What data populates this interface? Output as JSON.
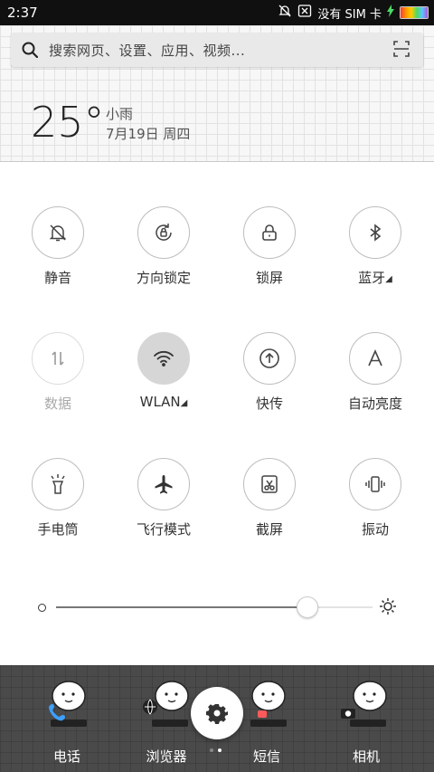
{
  "status_bar": {
    "time": "2:37",
    "carrier": "没有 SIM 卡",
    "battery_colors": [
      "#ff3b30",
      "#ff9500",
      "#ffcc00",
      "#4cd964",
      "#5ac8fa",
      "#af52de"
    ]
  },
  "search": {
    "placeholder": "搜索网页、设置、应用、视频..."
  },
  "weather": {
    "temperature": "25°",
    "condition": "小雨",
    "date": "7月19日 周四"
  },
  "toggles": [
    {
      "label": "静音",
      "state": "active"
    },
    {
      "label": "方向锁定",
      "state": "off"
    },
    {
      "label": "锁屏",
      "state": "off"
    },
    {
      "label": "蓝牙",
      "state": "off",
      "has_more": true
    },
    {
      "label": "数据",
      "state": "disabled"
    },
    {
      "label": "WLAN",
      "state": "active",
      "has_more": true
    },
    {
      "label": "快传",
      "state": "off"
    },
    {
      "label": "自动亮度",
      "state": "off"
    },
    {
      "label": "手电筒",
      "state": "off"
    },
    {
      "label": "飞行模式",
      "state": "off"
    },
    {
      "label": "截屏",
      "state": "off"
    },
    {
      "label": "振动",
      "state": "off"
    }
  ],
  "brightness": {
    "level": 0.79
  },
  "dock": {
    "apps": [
      {
        "label": "电话"
      },
      {
        "label": "浏览器"
      },
      {
        "label": "短信"
      },
      {
        "label": "相机"
      }
    ],
    "page_indicator": {
      "pages": 2,
      "current": 2
    }
  }
}
